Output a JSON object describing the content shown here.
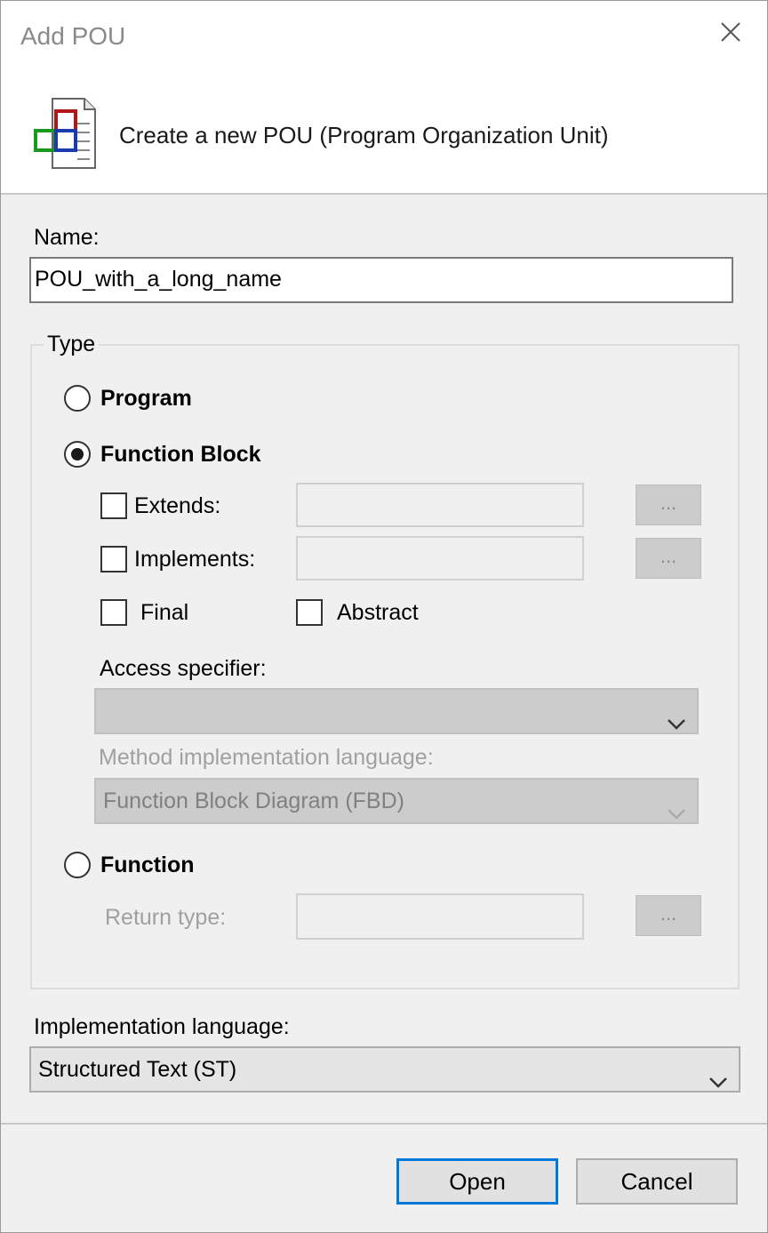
{
  "window": {
    "title": "Add POU",
    "close_icon": "close-icon"
  },
  "header": {
    "icon": "pou-document-icon",
    "text": "Create a new POU (Program Organization Unit)"
  },
  "name": {
    "label": "Name:",
    "value": "POU_with_a_long_name"
  },
  "type": {
    "group_label": "Type",
    "selected": "Function Block",
    "program_label": "Program",
    "function_block_label": "Function Block",
    "extends_label": "Extends:",
    "extends_value": "",
    "extends_browse": "...",
    "implements_label": "Implements:",
    "implements_value": "",
    "implements_browse": "...",
    "final_label": "Final",
    "abstract_label": "Abstract",
    "access_specifier_label": "Access specifier:",
    "access_specifier_value": "",
    "method_lang_label": "Method implementation language:",
    "method_lang_value": "Function Block Diagram (FBD)",
    "function_label": "Function",
    "return_type_label": "Return type:",
    "return_type_value": "",
    "return_type_browse": "..."
  },
  "impl_lang": {
    "label": "Implementation language:",
    "value": "Structured Text (ST)"
  },
  "buttons": {
    "open": "Open",
    "cancel": "Cancel"
  },
  "colors": {
    "accent": "#0078d7",
    "dialog_bg": "#f0f0f0",
    "disabled_text": "#a0a0a0"
  }
}
